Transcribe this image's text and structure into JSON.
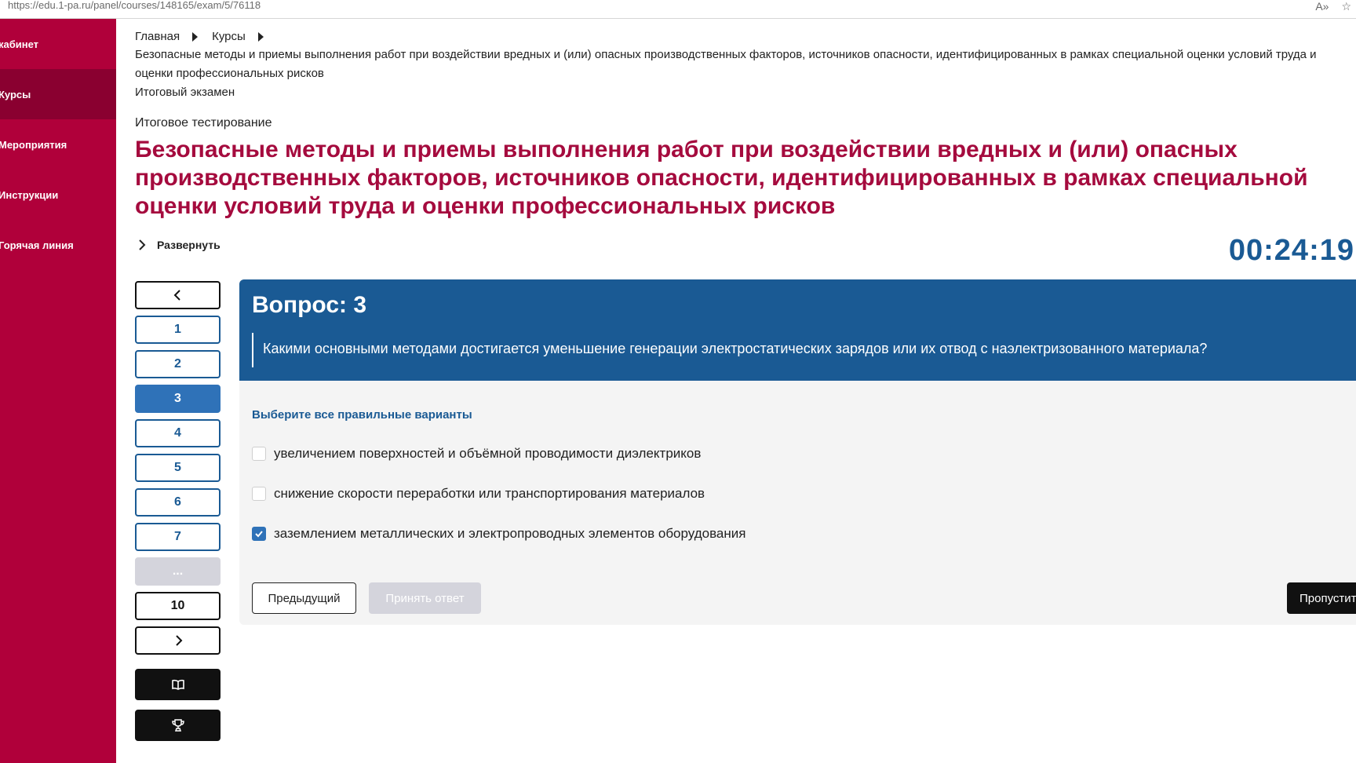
{
  "browser": {
    "url": "https://edu.1-pa.ru/panel/courses/148165/exam/5/76118",
    "read_aloud_icon": "A»",
    "favorite_icon": "☆"
  },
  "sidebar": {
    "items": [
      {
        "label": "кабинет"
      },
      {
        "label": "Курсы"
      },
      {
        "label": "Мероприятия"
      },
      {
        "label": "Инструкции"
      },
      {
        "label": "Горячая линия"
      }
    ]
  },
  "breadcrumbs": {
    "home": "Главная",
    "courses": "Курсы",
    "course": "Безопасные методы и приемы выполнения работ при воздействии вредных и (или) опасных производственных факторов, источников опасности, идентифицированных в рамках специальной оценки условий труда и оценки профессиональных рисков",
    "exam": "Итоговый экзамен"
  },
  "page": {
    "subtitle": "Итоговое тестирование",
    "title": "Безопасные методы и приемы выполнения работ при воздействии вредных и (или) опасных производственных факторов, источников опасности, идентифицированных в рамках специальной оценки условий труда и оценки профессиональных рисков",
    "expand_label": "Развернуть",
    "timer": "00:24:19"
  },
  "question_nav": {
    "items": [
      "1",
      "2",
      "3",
      "4",
      "5",
      "6",
      "7",
      "...",
      "10"
    ],
    "current": "3"
  },
  "question": {
    "number_label": "Вопрос: 3",
    "text": "Какими основными методами достигается уменьшение генерации электростатических зарядов или их отвод с наэлектризованного материала?",
    "hint": "Выберите все правильные варианты",
    "options": [
      {
        "label": "увеличением поверхностей и объёмной проводимости диэлектриков",
        "checked": false
      },
      {
        "label": "снижение скорости переработки или транспортирования материалов",
        "checked": false
      },
      {
        "label": "заземлением металлических и электропроводных элементов оборудования",
        "checked": true
      }
    ],
    "prev_label": "Предыдущий",
    "accept_label": "Принять ответ",
    "skip_label": "Пропустить"
  },
  "colors": {
    "sidebar": "#b0003a",
    "title": "#a50b3e",
    "primary": "#1a5a94"
  }
}
